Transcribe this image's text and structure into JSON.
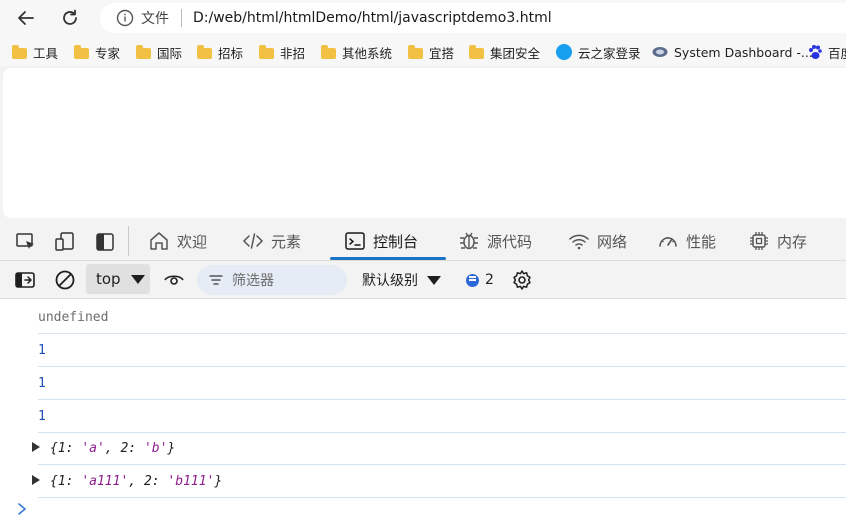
{
  "browser": {
    "url_scheme_label": "文件",
    "url": "D:/web/html/htmlDemo/html/javascriptdemo3.html",
    "icons": [
      "back-arrow-icon",
      "reload-icon",
      "info-icon"
    ]
  },
  "bookmarks": [
    {
      "label": "工具",
      "icon": "folder-icon"
    },
    {
      "label": "专家",
      "icon": "folder-icon"
    },
    {
      "label": "国际",
      "icon": "folder-icon"
    },
    {
      "label": "招标",
      "icon": "folder-icon"
    },
    {
      "label": "非招",
      "icon": "folder-icon"
    },
    {
      "label": "其他系统",
      "icon": "folder-icon"
    },
    {
      "label": "宜搭",
      "icon": "folder-icon"
    },
    {
      "label": "集团安全",
      "icon": "folder-icon"
    },
    {
      "label": "云之家登录",
      "icon": "cloud-icon"
    },
    {
      "label": "System Dashboard -...",
      "icon": "dashboard-icon"
    },
    {
      "label": "百度",
      "icon": "baidu-paw-icon"
    }
  ],
  "devtools": {
    "tabs": [
      {
        "label": "欢迎",
        "icon": "home-icon"
      },
      {
        "label": "元素",
        "icon": "code-tag-icon"
      },
      {
        "label": "控制台",
        "icon": "console-icon",
        "active": true
      },
      {
        "label": "源代码",
        "icon": "bug-icon"
      },
      {
        "label": "网络",
        "icon": "wifi-icon"
      },
      {
        "label": "性能",
        "icon": "gauge-icon"
      },
      {
        "label": "内存",
        "icon": "chip-icon"
      }
    ],
    "left_icons": [
      "inspect-element-icon",
      "device-emulation-icon",
      "dock-panel-icon"
    ],
    "accent_color": "#1a73c8"
  },
  "console_toolbar": {
    "context": "top",
    "filter_placeholder": "筛选器",
    "level": "默认级别",
    "issue_count": "2",
    "icons": [
      "sidebar-toggle-icon",
      "clear-console-icon",
      "live-expression-eye-icon",
      "filter-icon",
      "settings-gear-icon"
    ]
  },
  "console_output": [
    {
      "type": "undefined",
      "text": "undefined"
    },
    {
      "type": "number",
      "text": "1"
    },
    {
      "type": "number",
      "text": "1"
    },
    {
      "type": "number",
      "text": "1"
    },
    {
      "type": "object",
      "text_open": "{",
      "k1": "1",
      "v1": "'a'",
      "k2": "2",
      "v2": "'b'",
      "text_close": "}"
    },
    {
      "type": "object",
      "text_open": "{",
      "k1": "1",
      "v1": "'a111'",
      "k2": "2",
      "v2": "'b111'",
      "text_close": "}"
    }
  ]
}
